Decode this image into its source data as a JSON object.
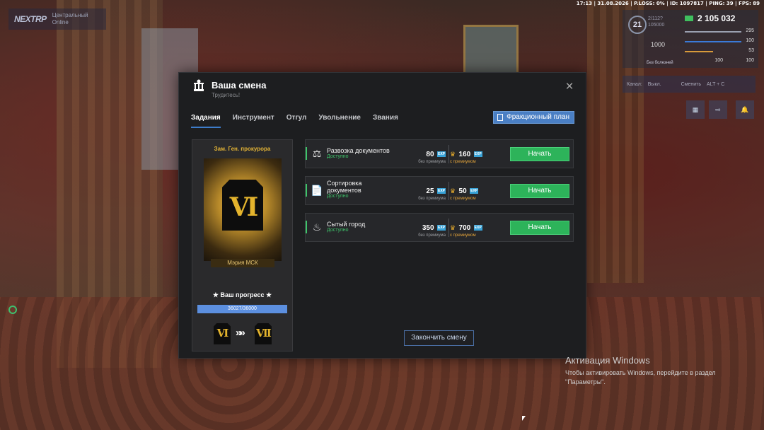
{
  "hud": {
    "status_line": "17:13 | 31.08.2026 | P.LOSS: 0% | ID: 1097817 | PING: 39 | FPS: 89",
    "logo": "NEXTRP",
    "server_name": "Центральный",
    "server_online": "Online",
    "level": "21",
    "exp": [
      "2/112?",
      "105000"
    ],
    "money": "2 105 032",
    "stat_armor": "295",
    "stat_hunger": "100",
    "stat_thirst": "53",
    "stat_a": "100",
    "stat_b": "100",
    "hp_value": "1000",
    "health_label": "Без болезней",
    "channel_label": "Канал:",
    "channel_value": "Выкл.",
    "channel_switch": "Сменить",
    "channel_keys": "ALT + C"
  },
  "modal": {
    "title": "Ваша смена",
    "subtitle": "Трудитесь!",
    "close_icon": "×",
    "tabs": [
      "Задания",
      "Инструмент",
      "Отгул",
      "Увольнение",
      "Звания"
    ],
    "active_tab": "Задания",
    "faction_plan_label": "Фракционный план",
    "finish_label": "Закончить смену"
  },
  "rank": {
    "title": "Зам. Ген. прокурора",
    "numeral": "VI",
    "organization": "Мэрия МСК",
    "progress_label": "★ Ваш прогресс ★",
    "progress_text": "36027/36000",
    "progress_fraction": 1.0,
    "current_numeral": "VI",
    "next_numeral": "VII",
    "arrows": "»»"
  },
  "tasks": [
    {
      "name": "Развозка документов",
      "status": "Доступно",
      "exp": "80",
      "exp_premium": "160",
      "icon": "⚖",
      "start": "Начать"
    },
    {
      "name": "Сортировка документов",
      "status": "Доступно",
      "exp": "25",
      "exp_premium": "50",
      "icon": "📄",
      "start": "Начать"
    },
    {
      "name": "Сытый город",
      "status": "Доступно",
      "exp": "350",
      "exp_premium": "700",
      "icon": "♨",
      "start": "Начать"
    }
  ],
  "labels": {
    "exp_chip": "EXP",
    "no_premium": "без премиума",
    "with_premium": "с премиумом"
  },
  "watermark": {
    "heading": "Активация Windows",
    "line1": "Чтобы активировать Windows, перейдите в раздел",
    "line2": "\"Параметры\"."
  },
  "colors": {
    "accent": "#3d7cc9",
    "start_button": "#2db35a",
    "rank_gold": "#e2b336",
    "exp_chip": "#38a3d8",
    "status_ok": "#3ec46a"
  }
}
